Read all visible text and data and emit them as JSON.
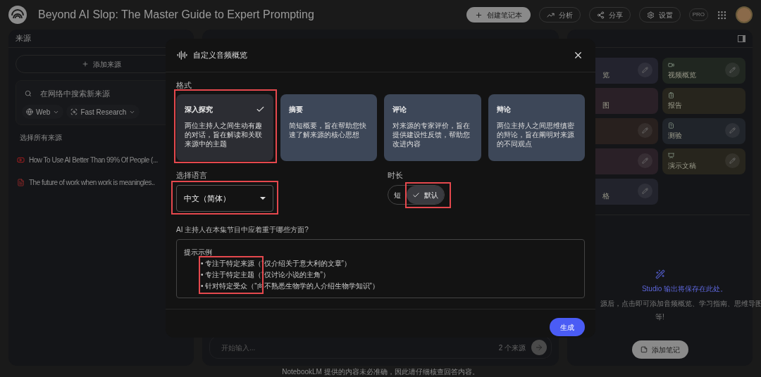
{
  "app": {
    "title": "Beyond AI Slop: The Master Guide to Expert Prompting",
    "create_button": "创建笔记本",
    "header_buttons": [
      {
        "kind": "analytics",
        "label": "分析"
      },
      {
        "kind": "share",
        "label": "分享"
      },
      {
        "kind": "settings",
        "label": "设置"
      }
    ],
    "badge": "PRO"
  },
  "sources": {
    "title": "来源",
    "add_button": "添加来源",
    "search": {
      "placeholder": "在网络中搜索新来源"
    },
    "chips": [
      {
        "kind": "web",
        "label": "Web"
      },
      {
        "kind": "research",
        "label": "Fast Research"
      }
    ],
    "select_all": "选择所有来源",
    "items": [
      {
        "kind": "video",
        "title": "How To Use AI Better Than 99% Of People (..."
      },
      {
        "kind": "document",
        "title": "The future of work when work is meaningles.."
      }
    ]
  },
  "chat": {
    "placeholder": "开始输入...",
    "source_count": "2 个来源"
  },
  "studio": {
    "tiles": [
      {
        "label": "览",
        "color": "#23232e",
        "editable": true
      },
      {
        "label": "视频概览",
        "color": "#202620",
        "editable": true,
        "kind": "video"
      },
      {
        "label": "图",
        "color": "#2a2027",
        "editable": false
      },
      {
        "label": "报告",
        "color": "#27251d",
        "editable": false,
        "kind": "report"
      },
      {
        "color": "#28201e",
        "editable": true
      },
      {
        "label": "测验",
        "color": "#20242a",
        "editable": true,
        "kind": "quiz"
      },
      {
        "color": "#2a2027",
        "editable": true
      },
      {
        "label": "演示文稿",
        "color": "#27251d",
        "editable": true,
        "kind": "slides"
      },
      {
        "label": "格",
        "color": "#22232c",
        "editable": true
      }
    ],
    "empty_title": "Studio 输出将保存在此处。",
    "empty_text": "源后，点击即可添加音频概览、学习指南、思维导图",
    "empty_text_2": "等!",
    "add_note": "添加笔记"
  },
  "footer": "NotebookLM 提供的内容未必准确，因此请仔细核查回答内容。",
  "dialog": {
    "title": "自定义音频概览",
    "format_label": "格式",
    "formats": [
      {
        "name": "深入探究",
        "description": "两位主持人之间生动有趣的对话，旨在解读和关联来源中的主题",
        "selected": true,
        "highlighted": true
      },
      {
        "name": "摘要",
        "description": "简短概要，旨在帮助您快速了解来源的核心思想",
        "selected": false,
        "highlighted": false
      },
      {
        "name": "评论",
        "description": "对来源的专家评价，旨在提供建设性反馈，帮助您改进内容",
        "selected": false,
        "highlighted": false
      },
      {
        "name": "辩论",
        "description": "两位主持人之间思维缜密的辩论，旨在阐明对来源的不同观点",
        "selected": false,
        "highlighted": false
      }
    ],
    "language_label": "选择语言",
    "language": {
      "value": "中文（简体）",
      "highlighted": true
    },
    "length_label": "时长",
    "lengths": [
      {
        "label": "短",
        "selected": false,
        "highlighted": false
      },
      {
        "label": "默认",
        "selected": true,
        "highlighted": true
      }
    ],
    "focus_label": "AI 主持人在本集节目中应着重于哪些方面?",
    "prompt": {
      "hint_title": "提示示例",
      "hint_examples": [
        "• 专注于特定来源（“仅介绍关于意大利的文章”）",
        "• 专注于特定主题（“仅讨论小说的主角”）",
        "• 针对特定受众（“向不熟悉生物学的人介绍生物学知识”）"
      ],
      "examples_highlighted": true
    },
    "generate_button": "生成"
  }
}
